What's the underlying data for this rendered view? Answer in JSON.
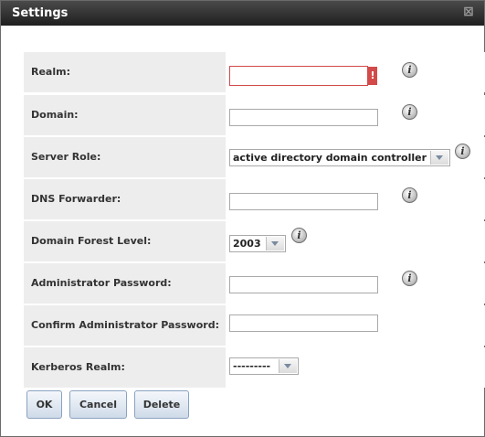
{
  "dialog": {
    "title": "Settings",
    "close_glyph": "⊠"
  },
  "fields": {
    "realm": {
      "label": "Realm:",
      "value": "",
      "error_glyph": "!"
    },
    "domain": {
      "label": "Domain:",
      "value": ""
    },
    "server_role": {
      "label": "Server Role:",
      "value": "active directory domain controller"
    },
    "dns_forwarder": {
      "label": "DNS Forwarder:",
      "value": ""
    },
    "domain_forest_level": {
      "label": "Domain Forest Level:",
      "value": "2003"
    },
    "admin_password": {
      "label": "Administrator Password:",
      "value": ""
    },
    "confirm_admin_password": {
      "label": "Confirm Administrator Password:",
      "value": ""
    },
    "kerberos_realm": {
      "label": "Kerberos Realm:",
      "value": "---------"
    }
  },
  "info_glyph": "i",
  "buttons": {
    "ok": "OK",
    "cancel": "Cancel",
    "delete": "Delete"
  },
  "colors": {
    "error": "#d24a4a",
    "label_bg": "#ededed",
    "button_border": "#8aa2bf"
  }
}
